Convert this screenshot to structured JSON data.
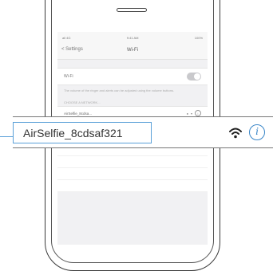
{
  "statusbar": {
    "carrier": "all 4G",
    "time": "9:41 AM",
    "battery": "100%"
  },
  "nav": {
    "back_label": "Settings",
    "title": "Wi-Fi"
  },
  "wifi": {
    "label": "Wi-Fi",
    "enabled": true
  },
  "note": "The volume of the ringer and alerts can be adjusted using the volume buttons.",
  "section_header": "CHOOSE A NETWORK...",
  "networks": [
    {
      "name": "AirSelfie_8cdsa...",
      "lock": "a"
    }
  ],
  "callout": {
    "ssid": "AirSelfie_8cdsaf321"
  },
  "icons": {
    "wifi": "wifi-icon",
    "info": "info-icon",
    "info_glyph": "i"
  },
  "colors": {
    "accent": "#3a86c8"
  }
}
